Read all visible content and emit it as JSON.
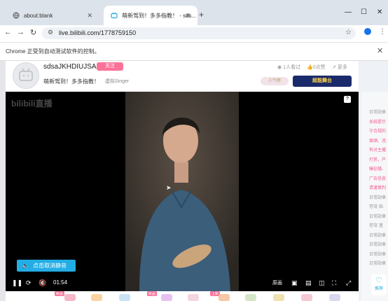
{
  "browser": {
    "tabs": [
      {
        "label": "about:blank"
      },
      {
        "label": "萌新驾到！多多指教！ - sds..."
      }
    ],
    "url": "live.bilibili.com/1778759150",
    "infobar": "Chrome 正受到自动测试软件的控制。"
  },
  "room": {
    "username": "sdsaJKHDIUJSA",
    "follow_label": "关注",
    "title": "萌新驾到！多多指教！",
    "category": "虚拟Singer",
    "watching": "1人看过",
    "likes": "0点赞",
    "more": "更多",
    "popularity": "人气榜",
    "banner": "超能舞台"
  },
  "player": {
    "watermark": "bilibili直播",
    "help": "?",
    "unmute_label": "点击取消静音",
    "time": "01:54",
    "quality": "原画"
  },
  "chat": {
    "lines": [
      {
        "text": "日常勋章",
        "pink": false
      },
      {
        "text": "系统提示",
        "pink": true
      },
      {
        "text": "守合规的",
        "pink": true
      },
      {
        "text": "烟酒、违",
        "pink": true
      },
      {
        "text": "有对主播",
        "pink": true
      },
      {
        "text": "打赏，产",
        "pink": true
      },
      {
        "text": "骗征婚、",
        "pink": true
      },
      {
        "text": "广告信息",
        "pink": true
      },
      {
        "text": "请谨慎判",
        "pink": true
      },
      {
        "text": "日常勋章",
        "pink": false
      },
      {
        "text": "苍穹·焰",
        "pink": false
      },
      {
        "text": "日常勋章",
        "pink": false
      },
      {
        "text": "苍穹·蓬",
        "pink": false
      },
      {
        "text": "日常勋章",
        "pink": false
      },
      {
        "text": "日常勋章",
        "pink": false
      },
      {
        "text": "日常勋章",
        "pink": false
      },
      {
        "text": "日常勋章",
        "pink": false
      }
    ],
    "recommend": "推荐"
  },
  "gifts": {
    "tags": [
      "新品",
      "新品",
      "上新"
    ]
  },
  "colors": {
    "accent_pink": "#fb7299",
    "accent_blue": "#23ade5"
  }
}
